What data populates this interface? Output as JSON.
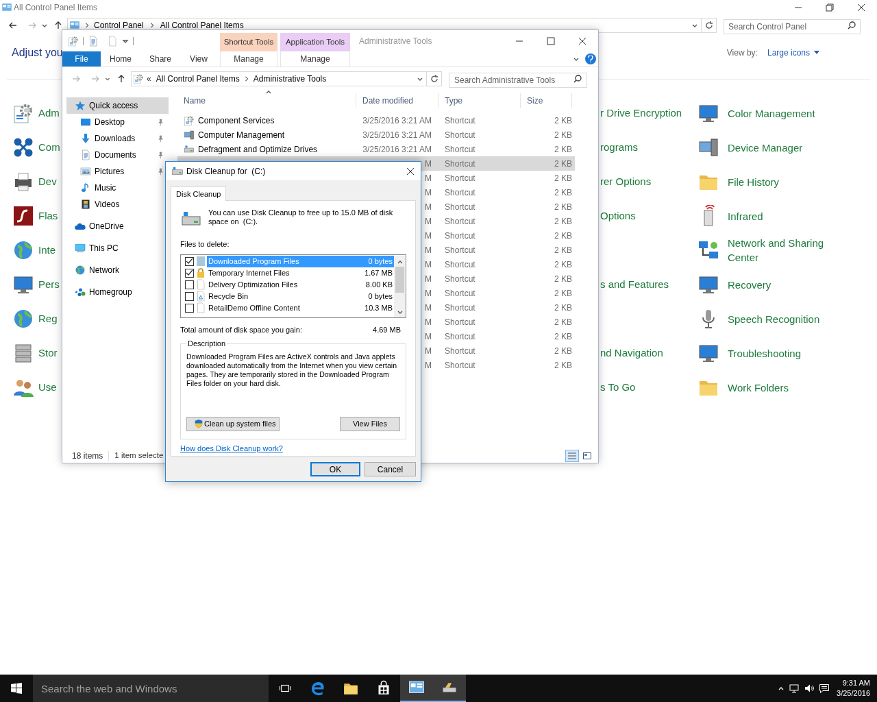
{
  "control_panel": {
    "title": "All Control Panel Items",
    "breadcrumb": [
      "Control Panel",
      "All Control Panel Items"
    ],
    "search": {
      "placeholder": "Search Control Panel"
    },
    "heading": "Adjust you",
    "view_by_label": "View by:",
    "view_by_value": "Large icons",
    "items_left": [
      "Adm",
      "Com",
      "Dev",
      "Flas",
      "Inte",
      "Pers",
      "Reg",
      "Stor",
      "Use"
    ],
    "item_rows": [
      {
        "middle": "r Drive Encryption",
        "right": "Color Management"
      },
      {
        "middle": "rograms",
        "right": "Device Manager"
      },
      {
        "middle": "rer Options",
        "right": "File History"
      },
      {
        "middle": "Options",
        "right": "Infrared"
      },
      {
        "right": "Network and Sharing Center"
      },
      {
        "middle": "s and Features",
        "right": "Recovery"
      },
      {
        "right": "Speech Recognition"
      },
      {
        "middle": "nd Navigation",
        "right": "Troubleshooting"
      },
      {
        "middle": "s To Go",
        "right": "Work Folders"
      }
    ]
  },
  "explorer": {
    "title": "Administrative Tools",
    "context_tabs": [
      {
        "group": "Shortcut Tools",
        "label": "Manage",
        "color": "#f9d3bd"
      },
      {
        "group": "Application Tools",
        "label": "Manage",
        "color": "#e9cdf5"
      }
    ],
    "ribbon_tabs": [
      {
        "label": "File",
        "kind": "file"
      },
      {
        "label": "Home",
        "kind": "tab"
      },
      {
        "label": "Share",
        "kind": "tab"
      },
      {
        "label": "View",
        "kind": "tab"
      }
    ],
    "address": {
      "prefix": "«",
      "breadcrumb": [
        "All Control Panel Items",
        "Administrative Tools"
      ]
    },
    "search": {
      "placeholder": "Search Administrative Tools"
    },
    "nav": [
      {
        "label": "Quick access",
        "selected": true,
        "children": [
          {
            "label": "Desktop",
            "pinned": true
          },
          {
            "label": "Downloads",
            "pinned": true
          },
          {
            "label": "Documents",
            "pinned": true
          },
          {
            "label": "Pictures",
            "pinned": true
          },
          {
            "label": "Music",
            "pinned": false
          },
          {
            "label": "Videos",
            "pinned": false
          }
        ]
      },
      {
        "label": "OneDrive",
        "selected": false
      },
      {
        "label": "This PC",
        "selected": false
      },
      {
        "label": "Network",
        "selected": false
      },
      {
        "label": "Homegroup",
        "selected": false
      }
    ],
    "columns": [
      "Name",
      "Date modified",
      "Type",
      "Size"
    ],
    "rows": [
      {
        "name": "Component Services",
        "date": "3/25/2016 3:21 AM",
        "type": "Shortcut",
        "size": "2 KB",
        "selected": false
      },
      {
        "name": "Computer Management",
        "date": "3/25/2016 3:21 AM",
        "type": "Shortcut",
        "size": "2 KB",
        "selected": false
      },
      {
        "name": "Defragment and Optimize Drives",
        "date": "3/25/2016 3:21 AM",
        "type": "Shortcut",
        "size": "2 KB",
        "selected": false
      },
      {
        "date": "M",
        "type": "Shortcut",
        "size": "2 KB",
        "selected": true
      },
      {
        "date": "M",
        "type": "Shortcut",
        "size": "2 KB",
        "selected": false
      },
      {
        "date": "M",
        "type": "Shortcut",
        "size": "2 KB",
        "selected": false
      },
      {
        "date": "M",
        "type": "Shortcut",
        "size": "2 KB",
        "selected": false
      },
      {
        "date": "M",
        "type": "Shortcut",
        "size": "2 KB",
        "selected": false
      },
      {
        "date": "M",
        "type": "Shortcut",
        "size": "2 KB",
        "selected": false
      },
      {
        "date": "M",
        "type": "Shortcut",
        "size": "2 KB",
        "selected": false
      },
      {
        "date": "M",
        "type": "Shortcut",
        "size": "2 KB",
        "selected": false
      },
      {
        "date": "M",
        "type": "Shortcut",
        "size": "2 KB",
        "selected": false
      },
      {
        "date": "M",
        "type": "Shortcut",
        "size": "2 KB",
        "selected": false
      },
      {
        "date": "M",
        "type": "Shortcut",
        "size": "2 KB",
        "selected": false
      },
      {
        "date": "M",
        "type": "Shortcut",
        "size": "2 KB",
        "selected": false
      },
      {
        "date": "M",
        "type": "Shortcut",
        "size": "2 KB",
        "selected": false
      },
      {
        "date": "M",
        "type": "Shortcut",
        "size": "2 KB",
        "selected": false
      },
      {
        "date": "M",
        "type": "Shortcut",
        "size": "2 KB",
        "selected": false
      }
    ],
    "status": {
      "count": "18 items",
      "selection": "1 item selecte"
    }
  },
  "dialog": {
    "title": "Disk Cleanup for  (C:)",
    "tab": "Disk Cleanup",
    "intro": "You can use Disk Cleanup to free up to 15.0 MB of disk space on  (C:).",
    "files_label": "Files to delete:",
    "files": [
      {
        "name": "Downloaded Program Files",
        "size": "0 bytes",
        "checked": true,
        "selected": true
      },
      {
        "name": "Temporary Internet Files",
        "size": "1.67 MB",
        "checked": true,
        "selected": false
      },
      {
        "name": "Delivery Optimization Files",
        "size": "8.00 KB",
        "checked": false,
        "selected": false
      },
      {
        "name": "Recycle Bin",
        "size": "0 bytes",
        "checked": false,
        "selected": false
      },
      {
        "name": "RetailDemo Offline Content",
        "size": "10.3 MB",
        "checked": false,
        "selected": false
      }
    ],
    "total_label": "Total amount of disk space you gain:",
    "total_value": "4.69 MB",
    "description_label": "Description",
    "description": "Downloaded Program Files are ActiveX controls and Java applets downloaded automatically from the Internet when you view certain pages. They are temporarily stored in the Downloaded Program Files folder on your hard disk.",
    "cleanup_button": "Clean up system files",
    "view_button": "View Files",
    "help_link": "How does Disk Cleanup work?",
    "ok": "OK",
    "cancel": "Cancel"
  },
  "taskbar": {
    "search": {
      "placeholder": "Search the web and Windows"
    },
    "apps": [
      {
        "active": false
      },
      {
        "active": false
      },
      {
        "active": false
      },
      {
        "active": false
      },
      {
        "active": true
      },
      {
        "active": true
      }
    ],
    "time": "9:31 AM",
    "date": "3/25/2016"
  }
}
